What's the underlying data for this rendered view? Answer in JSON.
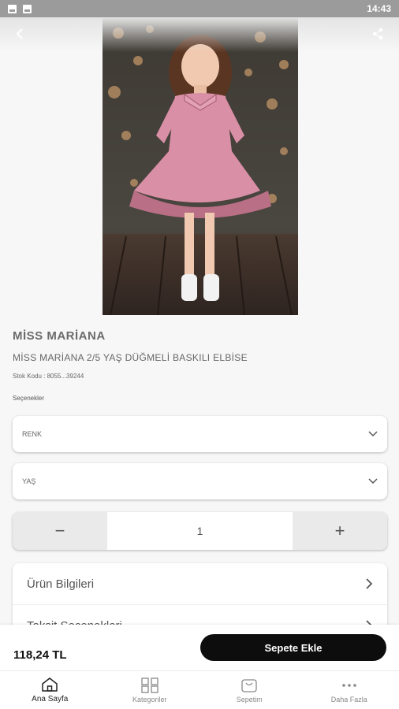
{
  "status_bar": {
    "time": "14:43",
    "icons": [
      "image-icon",
      "notification-icon"
    ]
  },
  "top_bar": {
    "back_icon": "chevron-left-icon",
    "share_icon": "share-icon"
  },
  "product": {
    "brand": "MİSS MARİANA",
    "title": "MİSS MARİANA 2/5 YAŞ DÜĞMELİ BASKILI ELBİSE",
    "stock_code": "Stok Kodu : 8055...39244",
    "image_alt": "product-photo"
  },
  "options": {
    "title": "Seçenekler",
    "renk": {
      "label": "RENK"
    },
    "yas": {
      "label": "YAŞ"
    }
  },
  "quantity": {
    "minus": "−",
    "value": "1",
    "plus": "+"
  },
  "info_rows": [
    {
      "label": "Ürün Bilgileri"
    },
    {
      "label": "Taksit Seçenekleri"
    }
  ],
  "purchase": {
    "price": "118,24 TL",
    "add_to_cart": "Sepete Ekle"
  },
  "tabs": [
    {
      "label": "Ana Sayfa",
      "icon": "home-icon",
      "active": true
    },
    {
      "label": "Kategoriler",
      "icon": "grid-icon",
      "active": false
    },
    {
      "label": "Sepetim",
      "icon": "cart-icon",
      "active": false
    },
    {
      "label": "Daha Fazla",
      "icon": "more-icon",
      "active": false
    }
  ],
  "colors": {
    "accent": "#0d0d0d",
    "background": "#f7f7f7",
    "status_bar": "#9b9b9b"
  }
}
